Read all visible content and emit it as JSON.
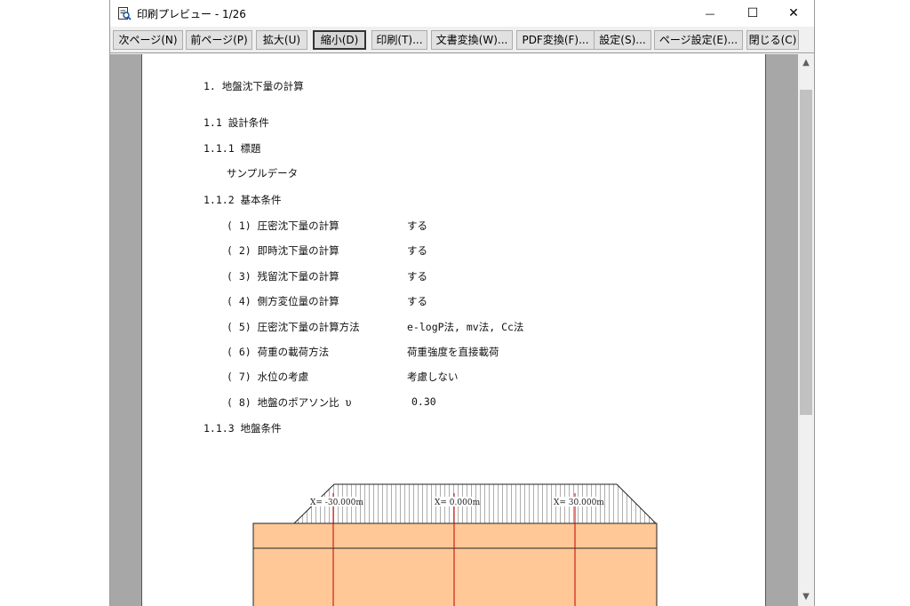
{
  "window": {
    "title": "印刷プレビュー - 1/26",
    "minimize_glyph": "—",
    "maximize_glyph": "☐",
    "close_glyph": "✕"
  },
  "toolbar": {
    "next_page": "次ページ(N)",
    "prev_page": "前ページ(P)",
    "zoom_in": "拡大(U)",
    "zoom_out": "縮小(D)",
    "print": "印刷(T)...",
    "doc_convert": "文書変換(W)...",
    "pdf_convert": "PDF変換(F)...",
    "settings": "設定(S)...",
    "page_setup": "ページ設定(E)...",
    "close": "閉じる(C)"
  },
  "document": {
    "heading1": "1. 地盤沈下量の計算",
    "section_1_1": "1.1 設計条件",
    "section_1_1_1": "1.1.1 標題",
    "title_value": "サンプルデータ",
    "section_1_1_2": "1.1.2 基本条件",
    "conditions": [
      {
        "label": "( 1) 圧密沈下量の計算",
        "value": "する"
      },
      {
        "label": "( 2) 即時沈下量の計算",
        "value": "する"
      },
      {
        "label": "( 3) 残留沈下量の計算",
        "value": "する"
      },
      {
        "label": "( 4) 側方変位量の計算",
        "value": "する"
      },
      {
        "label": "( 5) 圧密沈下量の計算方法",
        "value": "e-logP法, mv法, Cc法"
      },
      {
        "label": "( 6) 荷重の載荷方法",
        "value": "荷重強度を直接載荷"
      },
      {
        "label": "( 7) 水位の考慮",
        "value": "考慮しない"
      },
      {
        "label": "( 8) 地盤のポアソン比  υ",
        "value": "0.30"
      }
    ],
    "section_1_1_3": "1.1.3 地盤条件"
  },
  "diagram": {
    "labels": [
      "X= -30.000m",
      "X= 0.000m",
      "X= 30.000m"
    ],
    "soil_color": "#ffc896",
    "line_color": "#c00000"
  }
}
